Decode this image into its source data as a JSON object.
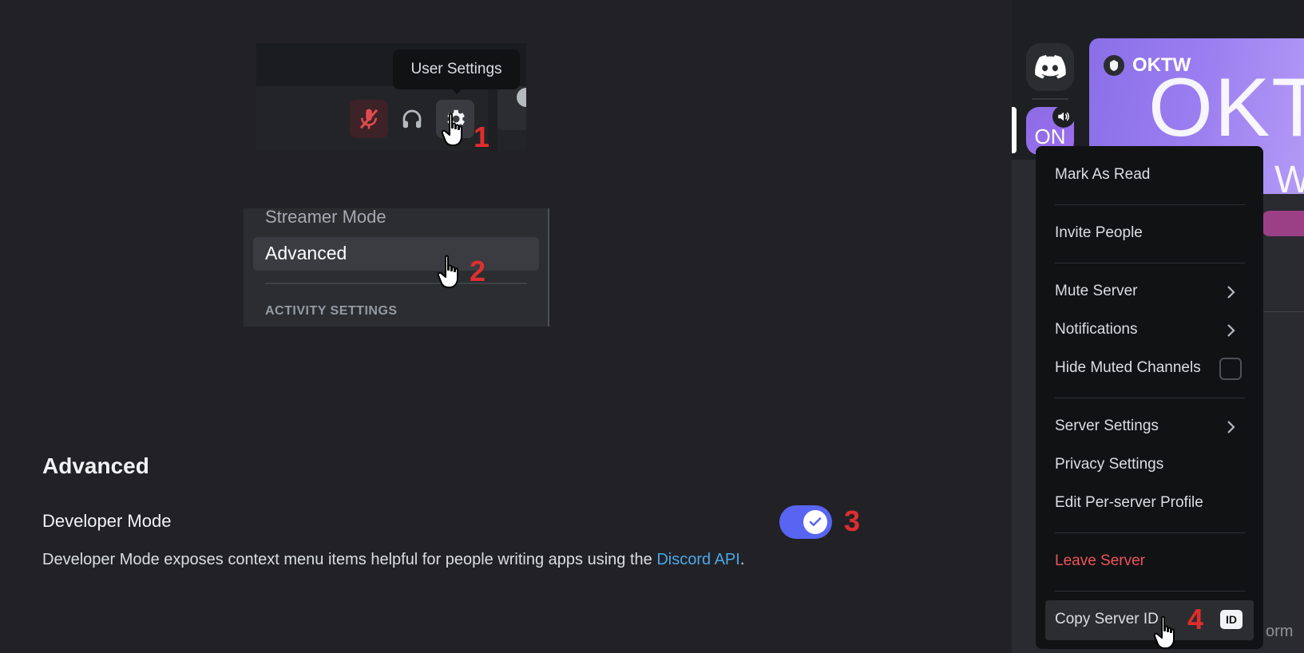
{
  "tooltip": {
    "text": "User Settings"
  },
  "steps": [
    "1",
    "2",
    "3",
    "4"
  ],
  "settings_nav": {
    "items": [
      "Streamer Mode",
      "Advanced"
    ],
    "section_header": "ACTIVITY SETTINGS"
  },
  "advanced": {
    "title": "Advanced",
    "developer_mode": {
      "title": "Developer Mode",
      "desc_prefix": "Developer Mode exposes context menu items helpful for people writing apps using the ",
      "link": "Discord API",
      "desc_suffix": ".",
      "enabled": true
    }
  },
  "server": {
    "icon_text": "ON",
    "name": "OKTW",
    "banner_text": "OKTW",
    "banner_text2": "WO"
  },
  "context_menu": {
    "items": [
      "Mark As Read",
      "Invite People",
      "Mute Server",
      "Notifications",
      "Hide Muted Channels",
      "Server Settings",
      "Privacy Settings",
      "Edit Per-server Profile",
      "Leave Server",
      "Copy Server ID"
    ],
    "id_badge": "ID"
  },
  "background_text": "orm",
  "colors": {
    "accent": "#5865f2",
    "danger": "#f0525b",
    "step_number": "#e02e2e",
    "link": "#4aa8e8"
  },
  "icons": [
    "mic-muted-icon",
    "headphones-icon",
    "gear-icon",
    "hand-cursor-icon",
    "discord-logo-icon",
    "speaker-icon",
    "check-icon",
    "chevron-right-icon"
  ]
}
